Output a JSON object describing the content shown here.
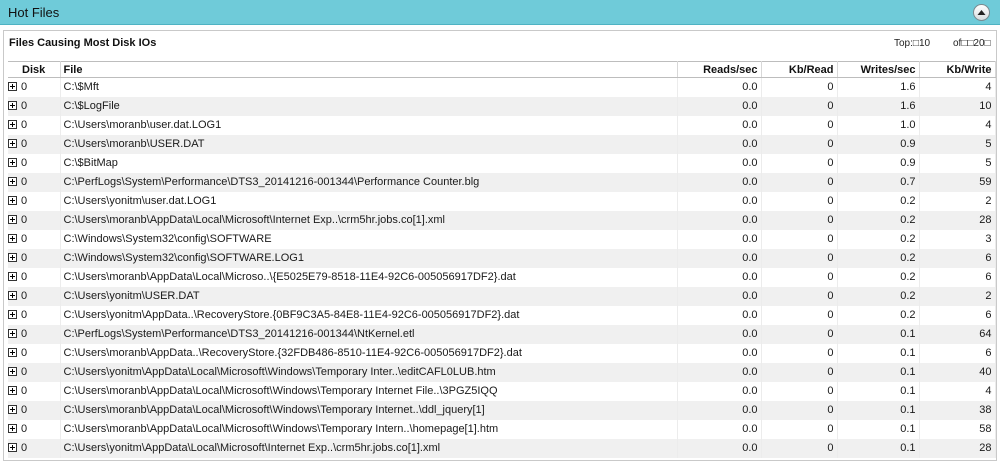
{
  "panel": {
    "title": "Hot Files",
    "subtitle": "Files Causing Most Disk IOs",
    "top_label": "Top:□10",
    "of_label": "of□□20□"
  },
  "table": {
    "columns": [
      "Disk",
      "File",
      "Reads/sec",
      "Kb/Read",
      "Writes/sec",
      "Kb/Write"
    ],
    "rows": [
      {
        "disk": "0",
        "file": "C:\\$Mft",
        "reads": "0.0",
        "kb_read": "0",
        "writes": "1.6",
        "kb_write": "4"
      },
      {
        "disk": "0",
        "file": "C:\\$LogFile",
        "reads": "0.0",
        "kb_read": "0",
        "writes": "1.6",
        "kb_write": "10"
      },
      {
        "disk": "0",
        "file": "C:\\Users\\moranb\\user.dat.LOG1",
        "reads": "0.0",
        "kb_read": "0",
        "writes": "1.0",
        "kb_write": "4"
      },
      {
        "disk": "0",
        "file": "C:\\Users\\moranb\\USER.DAT",
        "reads": "0.0",
        "kb_read": "0",
        "writes": "0.9",
        "kb_write": "5"
      },
      {
        "disk": "0",
        "file": "C:\\$BitMap",
        "reads": "0.0",
        "kb_read": "0",
        "writes": "0.9",
        "kb_write": "5"
      },
      {
        "disk": "0",
        "file": "C:\\PerfLogs\\System\\Performance\\DTS3_20141216-001344\\Performance Counter.blg",
        "reads": "0.0",
        "kb_read": "0",
        "writes": "0.7",
        "kb_write": "59"
      },
      {
        "disk": "0",
        "file": "C:\\Users\\yonitm\\user.dat.LOG1",
        "reads": "0.0",
        "kb_read": "0",
        "writes": "0.2",
        "kb_write": "2"
      },
      {
        "disk": "0",
        "file": "C:\\Users\\moranb\\AppData\\Local\\Microsoft\\Internet Exp..\\crm5hr.jobs.co[1].xml",
        "reads": "0.0",
        "kb_read": "0",
        "writes": "0.2",
        "kb_write": "28"
      },
      {
        "disk": "0",
        "file": "C:\\Windows\\System32\\config\\SOFTWARE",
        "reads": "0.0",
        "kb_read": "0",
        "writes": "0.2",
        "kb_write": "3"
      },
      {
        "disk": "0",
        "file": "C:\\Windows\\System32\\config\\SOFTWARE.LOG1",
        "reads": "0.0",
        "kb_read": "0",
        "writes": "0.2",
        "kb_write": "6"
      },
      {
        "disk": "0",
        "file": "C:\\Users\\moranb\\AppData\\Local\\Microso..\\{E5025E79-8518-11E4-92C6-005056917DF2}.dat",
        "reads": "0.0",
        "kb_read": "0",
        "writes": "0.2",
        "kb_write": "6"
      },
      {
        "disk": "0",
        "file": "C:\\Users\\yonitm\\USER.DAT",
        "reads": "0.0",
        "kb_read": "0",
        "writes": "0.2",
        "kb_write": "2"
      },
      {
        "disk": "0",
        "file": "C:\\Users\\yonitm\\AppData..\\RecoveryStore.{0BF9C3A5-84E8-11E4-92C6-005056917DF2}.dat",
        "reads": "0.0",
        "kb_read": "0",
        "writes": "0.2",
        "kb_write": "6"
      },
      {
        "disk": "0",
        "file": "C:\\PerfLogs\\System\\Performance\\DTS3_20141216-001344\\NtKernel.etl",
        "reads": "0.0",
        "kb_read": "0",
        "writes": "0.1",
        "kb_write": "64"
      },
      {
        "disk": "0",
        "file": "C:\\Users\\moranb\\AppData..\\RecoveryStore.{32FDB486-8510-11E4-92C6-005056917DF2}.dat",
        "reads": "0.0",
        "kb_read": "0",
        "writes": "0.1",
        "kb_write": "6"
      },
      {
        "disk": "0",
        "file": "C:\\Users\\yonitm\\AppData\\Local\\Microsoft\\Windows\\Temporary Inter..\\editCAFL0LUB.htm",
        "reads": "0.0",
        "kb_read": "0",
        "writes": "0.1",
        "kb_write": "40"
      },
      {
        "disk": "0",
        "file": "C:\\Users\\moranb\\AppData\\Local\\Microsoft\\Windows\\Temporary Internet File..\\3PGZ5IQQ",
        "reads": "0.0",
        "kb_read": "0",
        "writes": "0.1",
        "kb_write": "4"
      },
      {
        "disk": "0",
        "file": "C:\\Users\\moranb\\AppData\\Local\\Microsoft\\Windows\\Temporary Internet..\\ddl_jquery[1]",
        "reads": "0.0",
        "kb_read": "0",
        "writes": "0.1",
        "kb_write": "38"
      },
      {
        "disk": "0",
        "file": "C:\\Users\\moranb\\AppData\\Local\\Microsoft\\Windows\\Temporary Intern..\\homepage[1].htm",
        "reads": "0.0",
        "kb_read": "0",
        "writes": "0.1",
        "kb_write": "58"
      },
      {
        "disk": "0",
        "file": "C:\\Users\\yonitm\\AppData\\Local\\Microsoft\\Internet Exp..\\crm5hr.jobs.co[1].xml",
        "reads": "0.0",
        "kb_read": "0",
        "writes": "0.1",
        "kb_write": "28"
      }
    ]
  },
  "icons": {
    "collapse": "chevron-up-icon",
    "expander": "plus-box-icon"
  },
  "colors": {
    "title_bar": "#6fcbd9",
    "alt_row": "#f0f0f0"
  }
}
